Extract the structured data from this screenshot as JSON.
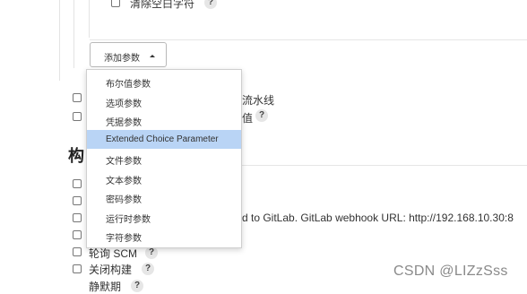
{
  "top_option": {
    "label": "清除空白字符",
    "help": "?"
  },
  "add_param_button": {
    "label": "添加参数"
  },
  "dropdown": {
    "items": [
      {
        "label": "布尔值参数",
        "highlighted": false
      },
      {
        "label": "选项参数",
        "highlighted": false
      },
      {
        "label": "凭据参数",
        "highlighted": false
      },
      {
        "label": "Extended Choice Parameter",
        "highlighted": true
      },
      {
        "label": "文件参数",
        "highlighted": false
      },
      {
        "label": "文本参数",
        "highlighted": false
      },
      {
        "label": "密码参数",
        "highlighted": false
      },
      {
        "label": "运行时参数",
        "highlighted": false
      },
      {
        "label": "字符参数",
        "highlighted": false
      }
    ]
  },
  "partial_options": {
    "pipeline_text": "流水线",
    "value_text": "值",
    "help": "?"
  },
  "section_heading": "构",
  "gitlab_trigger_text": "d to GitLab. GitLab webhook URL: http://192.168.10.30:8",
  "lower_options": [
    {
      "label": "轮询 SCM",
      "help": "?"
    },
    {
      "label": "关闭构建",
      "help": "?"
    },
    {
      "label": "静默期",
      "help": "?"
    }
  ],
  "watermark": "CSDN @LIZzSss",
  "colors": {
    "highlight": "#b9d4f5",
    "border": "#cfcfcf"
  }
}
